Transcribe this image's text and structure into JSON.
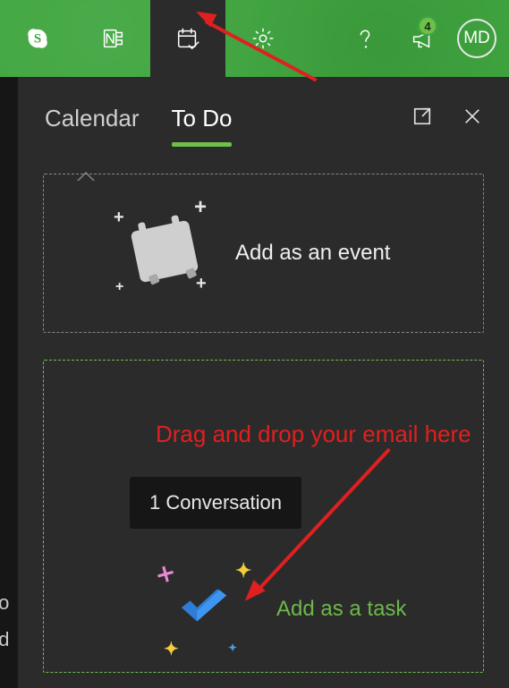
{
  "topbar": {
    "skype_icon": "S",
    "notification_count": "4",
    "avatar_initials": "MD"
  },
  "tabs": {
    "calendar": "Calendar",
    "todo": "To Do"
  },
  "event_zone": {
    "label": "Add as an event"
  },
  "task_zone": {
    "conversation_pill": "1 Conversation",
    "label": "Add as a task"
  },
  "annotations": {
    "drag_drop": "Drag and drop your email here"
  },
  "side": {
    "t1": "to",
    "t2": "ed"
  }
}
